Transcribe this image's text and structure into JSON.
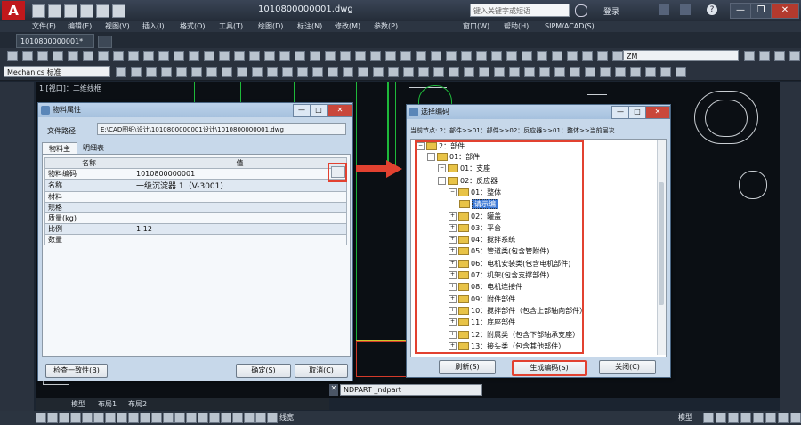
{
  "app": {
    "title": "1010800000001.dwg",
    "search_placeholder": "键入关键字或短语",
    "login": "登录"
  },
  "menu": [
    "文件(F)",
    "编辑(E)",
    "视图(V)",
    "插入(I)",
    "格式(O)",
    "工具(T)",
    "绘图(D)",
    "标注(N)",
    "修改(M)",
    "参数(P)",
    "窗口(W)",
    "帮助(H)",
    "SIPM/ACAD(S)"
  ],
  "doc_tab": "1010800000001*",
  "workspace": "Mechanics 标准",
  "layer_combo": "ZM_",
  "cmd_prompt": "NDPART _ndpart",
  "drawing_label": "1 [视口]：二维线框",
  "layout_tabs": [
    "模型",
    "布局1",
    "布局2"
  ],
  "status": {
    "model": "模型",
    "snap": "线宽"
  },
  "props_dialog": {
    "title": "物料属性",
    "path_label": "文件路径",
    "path_value": "E:\\CAD图纸\\设计\\1010800000001设计\\1010800000001.dwg",
    "tabs": [
      "物料主",
      "明细表"
    ],
    "headers": [
      "名称",
      "值"
    ],
    "rows": [
      {
        "name": "物料编码",
        "value": "1010800000001"
      },
      {
        "name": "名称",
        "value": "一级沉淀器 1（V-3001)"
      },
      {
        "name": "材料",
        "value": ""
      },
      {
        "name": "规格",
        "value": ""
      },
      {
        "name": "质量(kg)",
        "value": ""
      },
      {
        "name": "比例",
        "value": "1:12"
      },
      {
        "name": "数量",
        "value": ""
      }
    ],
    "browse_btn": "...",
    "left_btn": "检查一致性(B)",
    "ok_btn": "确定(S)",
    "cancel_btn": "取消(C)"
  },
  "tree_dialog": {
    "title": "选择编码",
    "breadcrumb": "当前节点: 2：部件>>01：部件>>02：反应器>>01：整体>>当前层次",
    "root": "2：部件",
    "items": [
      {
        "level": 1,
        "label": "01：部件"
      },
      {
        "level": 2,
        "label": "01：支座"
      },
      {
        "level": 2,
        "label": "02：反应器"
      },
      {
        "level": 3,
        "label": "01：整体"
      },
      {
        "level": 4,
        "label": "请示编",
        "selected": true
      },
      {
        "level": 3,
        "label": "02：罐盖"
      },
      {
        "level": 3,
        "label": "03：平台"
      },
      {
        "level": 3,
        "label": "04：搅拌系统"
      },
      {
        "level": 3,
        "label": "05：管道类(包含管附件)"
      },
      {
        "level": 3,
        "label": "06：电机安装类(包含电机部件)"
      },
      {
        "level": 3,
        "label": "07：机架(包含支撑部件)"
      },
      {
        "level": 3,
        "label": "08：电机连接件"
      },
      {
        "level": 3,
        "label": "09：附件部件"
      },
      {
        "level": 3,
        "label": "10：搅拌部件（包含上部轴向部件）"
      },
      {
        "level": 3,
        "label": "11：底座部件"
      },
      {
        "level": 3,
        "label": "12：附属类（包含下部轴承支座）"
      },
      {
        "level": 3,
        "label": "13：接头类（包含其他部件）"
      }
    ],
    "refresh_btn": "刷新(S)",
    "gen_btn": "生成编码(S)",
    "close_btn": "关闭(C)"
  },
  "colors": {
    "highlight": "#e24130",
    "arrow": "#e24130"
  }
}
